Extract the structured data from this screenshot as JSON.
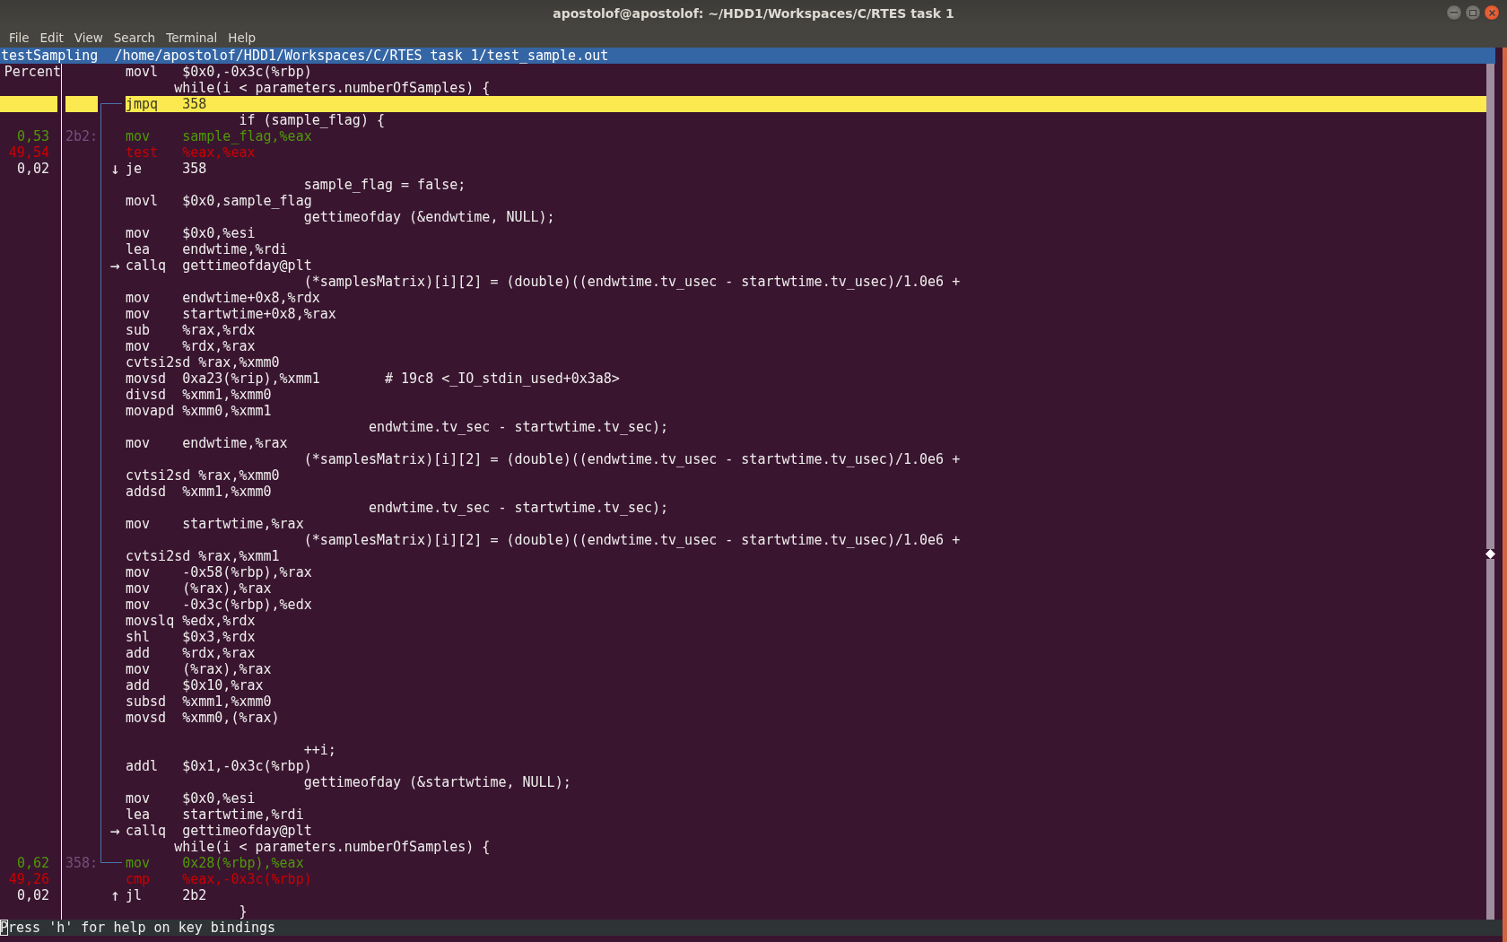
{
  "window": {
    "title": "apostolof@apostolof: ~/HDD1/Workspaces/C/RTES task 1"
  },
  "menu": [
    "File",
    "Edit",
    "View",
    "Search",
    "Terminal",
    "Help"
  ],
  "header": {
    "symbol": "testSampling",
    "path": "/home/apostolof/HDD1/Workspaces/C/RTES task 1/test_sample.out"
  },
  "percent_header": "Percent",
  "rows": [
    {
      "selected": false,
      "mnemonic": "movl",
      "operands": "$0x0,-0x3c(%rbp)"
    },
    {
      "selected": false,
      "source": "      while(i < parameters.numberOfSamples) {"
    },
    {
      "selected": true,
      "mnemonic": "jmpq",
      "operands": "358",
      "jump_from": true
    },
    {
      "selected": false,
      "source": "              if (sample_flag) {"
    },
    {
      "selected": false,
      "percent": "0,53",
      "color": "#4e9a06",
      "address": "2b2:",
      "mnemonic": "mov",
      "operands": "sample_flag,%eax"
    },
    {
      "selected": false,
      "percent": "49,54",
      "color": "#cc0000",
      "mnemonic": "test",
      "operands": "%eax,%eax"
    },
    {
      "selected": false,
      "percent": "0,02",
      "arrow": "↓",
      "mnemonic": "je",
      "operands": "358"
    },
    {
      "selected": false,
      "source": "                      sample_flag = false;"
    },
    {
      "selected": false,
      "mnemonic": "movl",
      "operands": "$0x0,sample_flag"
    },
    {
      "selected": false,
      "source": "                      gettimeofday (&endwtime, NULL);"
    },
    {
      "selected": false,
      "mnemonic": "mov",
      "operands": "$0x0,%esi"
    },
    {
      "selected": false,
      "mnemonic": "lea",
      "operands": "endwtime,%rdi"
    },
    {
      "selected": false,
      "arrow": "→",
      "mnemonic": "callq",
      "operands": "gettimeofday@plt"
    },
    {
      "selected": false,
      "source": "                      (*samplesMatrix)[i][2] = (double)((endwtime.tv_usec - startwtime.tv_usec)/1.0e6 +"
    },
    {
      "selected": false,
      "mnemonic": "mov",
      "operands": "endwtime+0x8,%rdx"
    },
    {
      "selected": false,
      "mnemonic": "mov",
      "operands": "startwtime+0x8,%rax"
    },
    {
      "selected": false,
      "mnemonic": "sub",
      "operands": "%rax,%rdx"
    },
    {
      "selected": false,
      "mnemonic": "mov",
      "operands": "%rdx,%rax"
    },
    {
      "selected": false,
      "mnemonic": "cvtsi2sd",
      "operands": "%rax,%xmm0"
    },
    {
      "selected": false,
      "mnemonic": "movsd",
      "operands": "0xa23(%rip),%xmm1        # 19c8 <_IO_stdin_used+0x3a8>"
    },
    {
      "selected": false,
      "mnemonic": "divsd",
      "operands": "%xmm1,%xmm0"
    },
    {
      "selected": false,
      "mnemonic": "movapd",
      "operands": "%xmm0,%xmm1"
    },
    {
      "selected": false,
      "source": "                              endwtime.tv_sec - startwtime.tv_sec);"
    },
    {
      "selected": false,
      "mnemonic": "mov",
      "operands": "endwtime,%rax"
    },
    {
      "selected": false,
      "source": "                      (*samplesMatrix)[i][2] = (double)((endwtime.tv_usec - startwtime.tv_usec)/1.0e6 +"
    },
    {
      "selected": false,
      "mnemonic": "cvtsi2sd",
      "operands": "%rax,%xmm0"
    },
    {
      "selected": false,
      "mnemonic": "addsd",
      "operands": "%xmm1,%xmm0"
    },
    {
      "selected": false,
      "source": "                              endwtime.tv_sec - startwtime.tv_sec);"
    },
    {
      "selected": false,
      "mnemonic": "mov",
      "operands": "startwtime,%rax"
    },
    {
      "selected": false,
      "source": "                      (*samplesMatrix)[i][2] = (double)((endwtime.tv_usec - startwtime.tv_usec)/1.0e6 +"
    },
    {
      "selected": false,
      "mnemonic": "cvtsi2sd",
      "operands": "%rax,%xmm1"
    },
    {
      "selected": false,
      "mnemonic": "mov",
      "operands": "-0x58(%rbp),%rax"
    },
    {
      "selected": false,
      "mnemonic": "mov",
      "operands": "(%rax),%rax"
    },
    {
      "selected": false,
      "mnemonic": "mov",
      "operands": "-0x3c(%rbp),%edx"
    },
    {
      "selected": false,
      "mnemonic": "movslq",
      "operands": "%edx,%rdx"
    },
    {
      "selected": false,
      "mnemonic": "shl",
      "operands": "$0x3,%rdx"
    },
    {
      "selected": false,
      "mnemonic": "add",
      "operands": "%rdx,%rax"
    },
    {
      "selected": false,
      "mnemonic": "mov",
      "operands": "(%rax),%rax"
    },
    {
      "selected": false,
      "mnemonic": "add",
      "operands": "$0x10,%rax"
    },
    {
      "selected": false,
      "mnemonic": "subsd",
      "operands": "%xmm1,%xmm0"
    },
    {
      "selected": false,
      "mnemonic": "movsd",
      "operands": "%xmm0,(%rax)"
    },
    {
      "selected": false
    },
    {
      "selected": false,
      "source": "                      ++i;"
    },
    {
      "selected": false,
      "mnemonic": "addl",
      "operands": "$0x1,-0x3c(%rbp)"
    },
    {
      "selected": false,
      "source": "                      gettimeofday (&startwtime, NULL);"
    },
    {
      "selected": false,
      "mnemonic": "mov",
      "operands": "$0x0,%esi"
    },
    {
      "selected": false,
      "mnemonic": "lea",
      "operands": "startwtime,%rdi"
    },
    {
      "selected": false,
      "arrow": "→",
      "mnemonic": "callq",
      "operands": "gettimeofday@plt"
    },
    {
      "selected": false,
      "source": "      while(i < parameters.numberOfSamples) {"
    },
    {
      "selected": false,
      "percent": "0,62",
      "color": "#4e9a06",
      "address": "358:",
      "mnemonic": "mov",
      "operands": "0x28(%rbp),%eax",
      "jump_to": true
    },
    {
      "selected": false,
      "percent": "49,26",
      "color": "#cc0000",
      "mnemonic": "cmp",
      "operands": "%eax,-0x3c(%rbp)"
    },
    {
      "selected": false,
      "percent": "0,02",
      "arrow": "↑",
      "mnemonic": "jl",
      "operands": "2b2"
    },
    {
      "selected": false,
      "source": "              }"
    }
  ],
  "status_bar": "Press 'h' for help on key bindings"
}
